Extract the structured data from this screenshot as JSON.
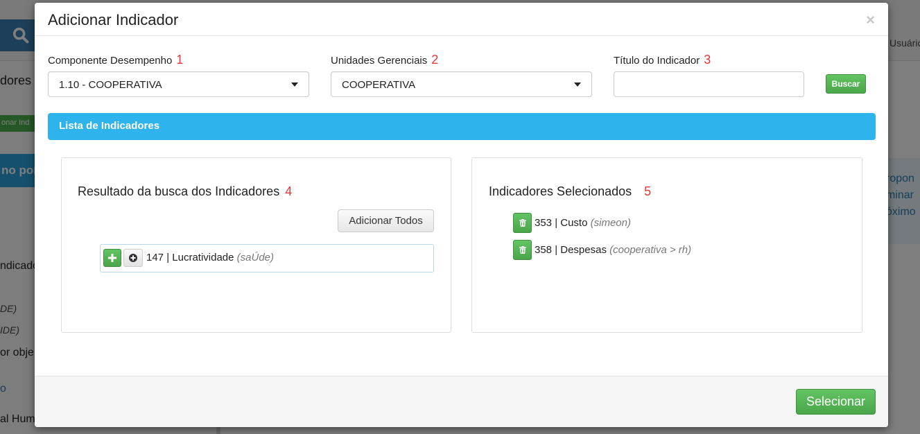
{
  "background": {
    "user_menu": "Usuário",
    "sidebar_fragments": [
      "dores",
      "onar Ind",
      "no por",
      "ndicado",
      "DE)",
      "IDE)",
      "or obje",
      "o",
      "al Huma"
    ],
    "right_fragments": [
      "ropon",
      "minar",
      "óximo"
    ]
  },
  "modal": {
    "title": "Adicionar Indicador",
    "close_glyph": "×",
    "fields": {
      "componente": {
        "label": "Componente Desempenho",
        "step": "1",
        "value": "1.10 - COOPERATIVA"
      },
      "unidades": {
        "label": "Unidades Gerenciais",
        "step": "2",
        "value": "COOPERATIVA"
      },
      "titulo": {
        "label": "Título do Indicador",
        "step": "3",
        "value": "",
        "placeholder": ""
      },
      "buscar_label": "Buscar"
    },
    "list_header": "Lista de Indicadores",
    "results": {
      "title": "Resultado da busca dos Indicadores",
      "step": "4",
      "add_all_label": "Adicionar Todos",
      "items": [
        {
          "id_name": "147 | Lucratividade",
          "sub": "(saÚde)"
        }
      ]
    },
    "selected": {
      "title": "Indicadores Selecionados",
      "step": "5",
      "items": [
        {
          "id_name": "353 | Custo",
          "sub": "(simeon)"
        },
        {
          "id_name": "358 | Despesas",
          "sub": "(cooperativa > rh)"
        }
      ]
    },
    "footer": {
      "select_label": "Selecionar"
    }
  },
  "colors": {
    "accent_blue": "#2fb3ec",
    "success_green": "#5cb85c",
    "step_red": "#e53935"
  }
}
